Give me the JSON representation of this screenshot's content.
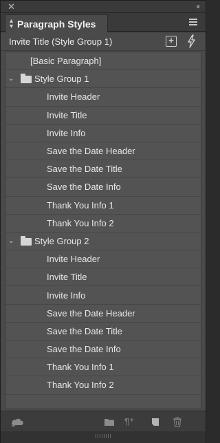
{
  "window": {
    "close_glyph": "✕",
    "collapse_glyph": "‹‹"
  },
  "panel": {
    "tab_label": "Paragraph Styles",
    "tab_arrows_up": "▴",
    "tab_arrows_down": "▾"
  },
  "current_style": {
    "name": "Invite Title (Style Group 1)"
  },
  "styles": {
    "basic": "[Basic Paragraph]",
    "groups": [
      {
        "name": "Style Group 1",
        "items": [
          "Invite Header",
          "Invite Title",
          "Invite Info",
          "Save the Date Header",
          "Save the Date Title",
          "Save the Date Info",
          "Thank You Info 1",
          "Thank You Info 2"
        ]
      },
      {
        "name": "Style Group 2",
        "items": [
          "Invite Header",
          "Invite Title",
          "Invite Info",
          "Save the Date Header",
          "Save the Date Title",
          "Save the Date Info",
          "Thank You Info 1",
          "Thank You Info 2"
        ]
      }
    ]
  },
  "footer": {
    "para_glyph": "¶⁺"
  },
  "icons": {
    "close": "close-icon",
    "collapse": "collapse-panels-icon",
    "panel_menu": "panel-menu-icon",
    "new_style_from_selection": "add-style-icon",
    "quick_apply": "lightning-bolt-icon",
    "cc_libraries": "cloud-icon",
    "new_group": "folder-icon",
    "clear_overrides": "clear-overrides-icon",
    "new_style": "new-style-icon",
    "delete": "trash-icon"
  },
  "colors": {
    "panel_bg": "#4a4a4a",
    "list_bg": "#535353",
    "text": "#e8e8e8",
    "icon": "#cfcfcf"
  }
}
